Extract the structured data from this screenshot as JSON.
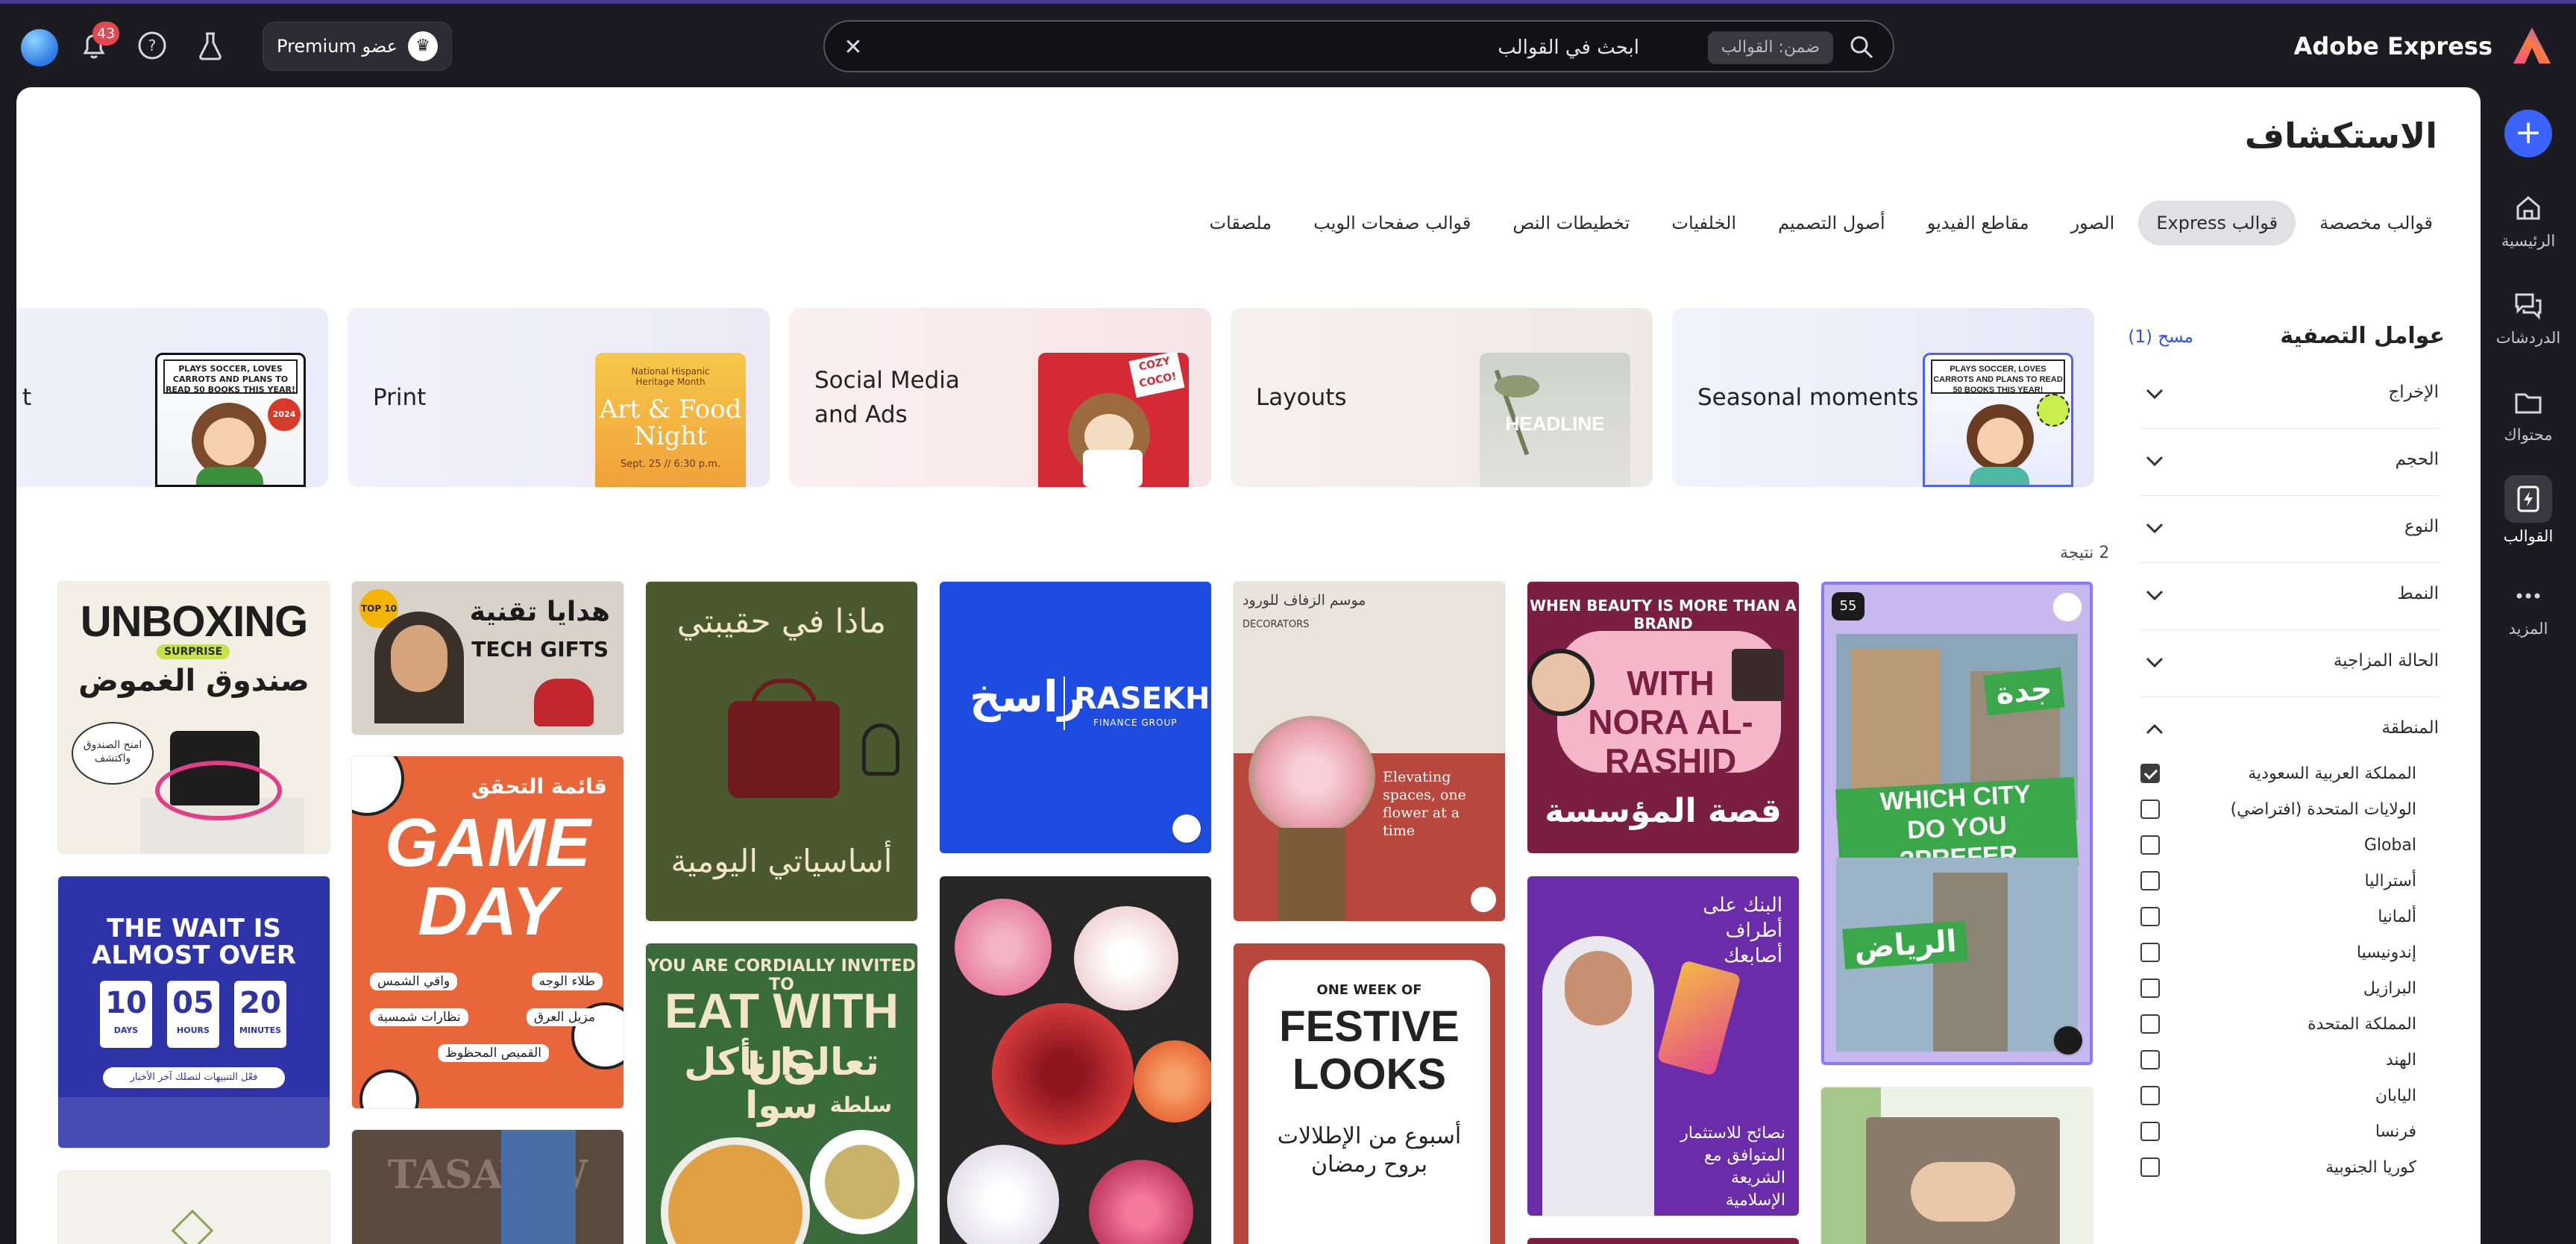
{
  "app": {
    "brand": "Adobe Express"
  },
  "search": {
    "scope": "ضمن: القوالب",
    "query": "ابحث في القوالب"
  },
  "account": {
    "premium_label": "عضو Premium",
    "notification_count": "43"
  },
  "rail": {
    "items": [
      {
        "label": "الرئيسية",
        "icon": "home-icon"
      },
      {
        "label": "الدردشات",
        "icon": "chat-icon"
      },
      {
        "label": "محتواك",
        "icon": "folder-icon"
      },
      {
        "label": "القوالب",
        "icon": "templates-icon"
      },
      {
        "label": "المزيد",
        "icon": "more-icon"
      }
    ]
  },
  "page": {
    "title": "الاستكشاف"
  },
  "tabs": [
    "قوالب مخصصة",
    "قوالب Express",
    "الصور",
    "مقاطع الفيديو",
    "أصول التصميم",
    "الخلفيات",
    "تخطيطات النص",
    "قوالب صفحات الويب",
    "ملصقات"
  ],
  "active_tab": "قوالب Express",
  "categories": [
    {
      "label": "Seasonal moments"
    },
    {
      "label": "Layouts"
    },
    {
      "label": "Social Media and Ads"
    },
    {
      "label": "Print"
    },
    {
      "label": "t"
    }
  ],
  "filters": {
    "title": "عوامل التصفية",
    "clear": "مسح (1)",
    "facets": [
      "الإخراج",
      "الحجم",
      "النوع",
      "النمط",
      "الحالة المزاجية",
      "المنطقة"
    ],
    "regions": [
      {
        "label": "المملكة العربية السعودية",
        "checked": true
      },
      {
        "label": "الولايات المتحدة (افتراضي)",
        "checked": false
      },
      {
        "label": "Global",
        "checked": false
      },
      {
        "label": "أستراليا",
        "checked": false
      },
      {
        "label": "ألمانيا",
        "checked": false
      },
      {
        "label": "إندونيسيا",
        "checked": false
      },
      {
        "label": "البرازيل",
        "checked": false
      },
      {
        "label": "المملكة المتحدة",
        "checked": false
      },
      {
        "label": "الهند",
        "checked": false
      },
      {
        "label": "اليابان",
        "checked": false
      },
      {
        "label": "فرنسا",
        "checked": false
      },
      {
        "label": "كوريا الجنوبية",
        "checked": false
      }
    ]
  },
  "results": {
    "count_label": "2 نتيجة"
  },
  "templates": {
    "unboxing": {
      "t1": "UNBOXING",
      "t2": "SURPRISE",
      "t3": "صندوق الغموض",
      "t4": "امنح الصندوق واكتشف"
    },
    "wait": {
      "t1": "THE WAIT IS ALMOST OVER",
      "d": "10",
      "h": "05",
      "m": "20",
      "dl": "DAYS",
      "hl": "HOURS",
      "ml": "MINUTES",
      "t2": "فعّل التنبيهات لتصلك آخر الأخبار"
    },
    "techgifts": {
      "t1": "هدايا تقنية",
      "t2": "TECH GIFTS",
      "badge": "TOP 10"
    },
    "gameday": {
      "t1": "قائمة التحقق",
      "t2": "GAME DAY",
      "items": [
        "طلاء الوجه",
        "واقي الشمس",
        "مزيل العرق",
        "نظارات شمسية",
        "القميص المحظوظ"
      ]
    },
    "tasaww": {
      "t1": "TASAWW"
    },
    "bag": {
      "t1": "ماذا في حقيبتي",
      "t2": "أساسياتي اليومية"
    },
    "eat": {
      "t1": "YOU ARE CORDIALLY INVITED TO",
      "t2": "EAT WITH US",
      "t3": "تعالوا نأكل سوا",
      "t4": "سلطة"
    },
    "rasekh": {
      "t1": "راسخ",
      "t2": "RASEKH",
      "t3": "FINANCE GROUP"
    },
    "flowers": {
      "t1": "موسم الزفاف للورود",
      "t2": "DECORATORS",
      "t3": "Elevating spaces, one flower at a time"
    },
    "festive": {
      "t1": "ONE WEEK OF",
      "t2": "FESTIVE LOOKS",
      "t3": "أسبوع من الإطلالات بروح رمضان"
    },
    "nora": {
      "t1": "WHEN BEAUTY IS MORE THAN A BRAND",
      "t2": "WITH NORA AL-RASHID",
      "t3": "قصة المؤسسة"
    },
    "bank": {
      "t1": "البنك على أطراف أصابعك",
      "t2": "نصائح للاستثمار المتوافق مع الشريعة الإسلامية"
    },
    "city": {
      "t1": "جدة",
      "t2": "WHICH CITY DO YOU PREFER?",
      "t3": "الرياض",
      "badge": "55"
    }
  },
  "colors": {
    "accent": "#3b63fb",
    "selection": "#8c77ff",
    "dark_bg": "#1d1b22"
  }
}
